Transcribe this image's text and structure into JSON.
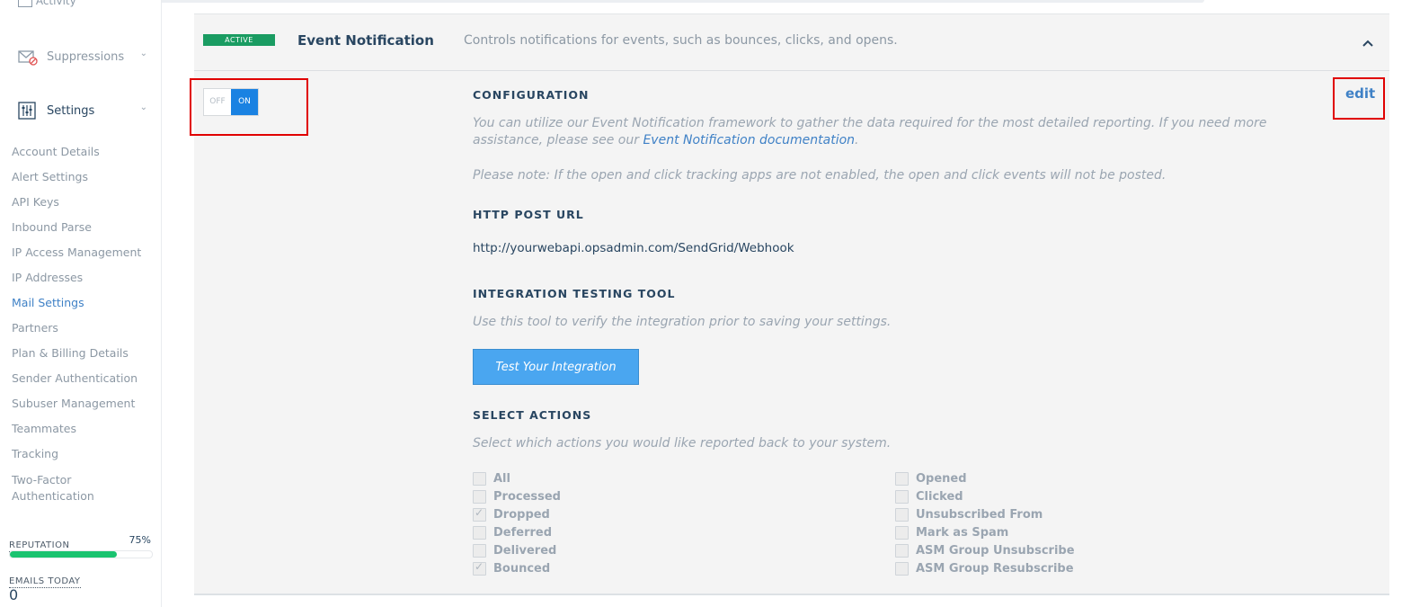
{
  "sidebar": {
    "top_item_label": "Activity",
    "suppressions_label": "Suppressions",
    "settings_label": "Settings",
    "sub_items": [
      {
        "label": "Account Details",
        "active": false
      },
      {
        "label": "Alert Settings",
        "active": false
      },
      {
        "label": "API Keys",
        "active": false
      },
      {
        "label": "Inbound Parse",
        "active": false
      },
      {
        "label": "IP Access Management",
        "active": false
      },
      {
        "label": "IP Addresses",
        "active": false
      },
      {
        "label": "Mail Settings",
        "active": true
      },
      {
        "label": "Partners",
        "active": false
      },
      {
        "label": "Plan & Billing Details",
        "active": false
      },
      {
        "label": "Sender Authentication",
        "active": false
      },
      {
        "label": "Subuser Management",
        "active": false
      },
      {
        "label": "Teammates",
        "active": false
      },
      {
        "label": "Tracking",
        "active": false
      },
      {
        "label": "Two-Factor Authentication",
        "active": false
      }
    ],
    "reputation_label": "REPUTATION",
    "reputation_value": "75%",
    "reputation_fraction": 0.75,
    "emails_today_label": "EMAILS TODAY",
    "emails_today_value": "0"
  },
  "panel": {
    "badge": "ACTIVE",
    "title": "Event Notification",
    "description": "Controls notifications for events, such as bounces, clicks, and opens.",
    "toggle_off": "OFF",
    "toggle_on": "ON",
    "edit_label": "edit",
    "configuration_heading": "CONFIGURATION",
    "config_text_before": "You can utilize our Event Notification framework to gather the data required for the most detailed reporting. If you need more assistance, please see our ",
    "config_link": "Event Notification documentation",
    "config_text_after": ".",
    "note": "Please note: If the open and click tracking apps are not enabled, the open and click events will not be posted.",
    "http_heading": "HTTP POST URL",
    "http_url": "http://yourwebapi.opsadmin.com/SendGrid/Webhook",
    "testing_heading": "INTEGRATION TESTING TOOL",
    "testing_text": "Use this tool to verify the integration prior to saving your settings.",
    "test_button": "Test Your Integration",
    "actions_heading": "SELECT ACTIONS",
    "actions_text": "Select which actions you would like reported back to your system.",
    "actions_left": [
      {
        "label": "All",
        "checked": false
      },
      {
        "label": "Processed",
        "checked": false
      },
      {
        "label": "Dropped",
        "checked": true
      },
      {
        "label": "Deferred",
        "checked": false
      },
      {
        "label": "Delivered",
        "checked": false
      },
      {
        "label": "Bounced",
        "checked": true
      }
    ],
    "actions_right": [
      {
        "label": "Opened",
        "checked": false
      },
      {
        "label": "Clicked",
        "checked": false
      },
      {
        "label": "Unsubscribed From",
        "checked": false
      },
      {
        "label": "Mark as Spam",
        "checked": false
      },
      {
        "label": "ASM Group Unsubscribe",
        "checked": false
      },
      {
        "label": "ASM Group Resubscribe",
        "checked": false
      }
    ]
  }
}
